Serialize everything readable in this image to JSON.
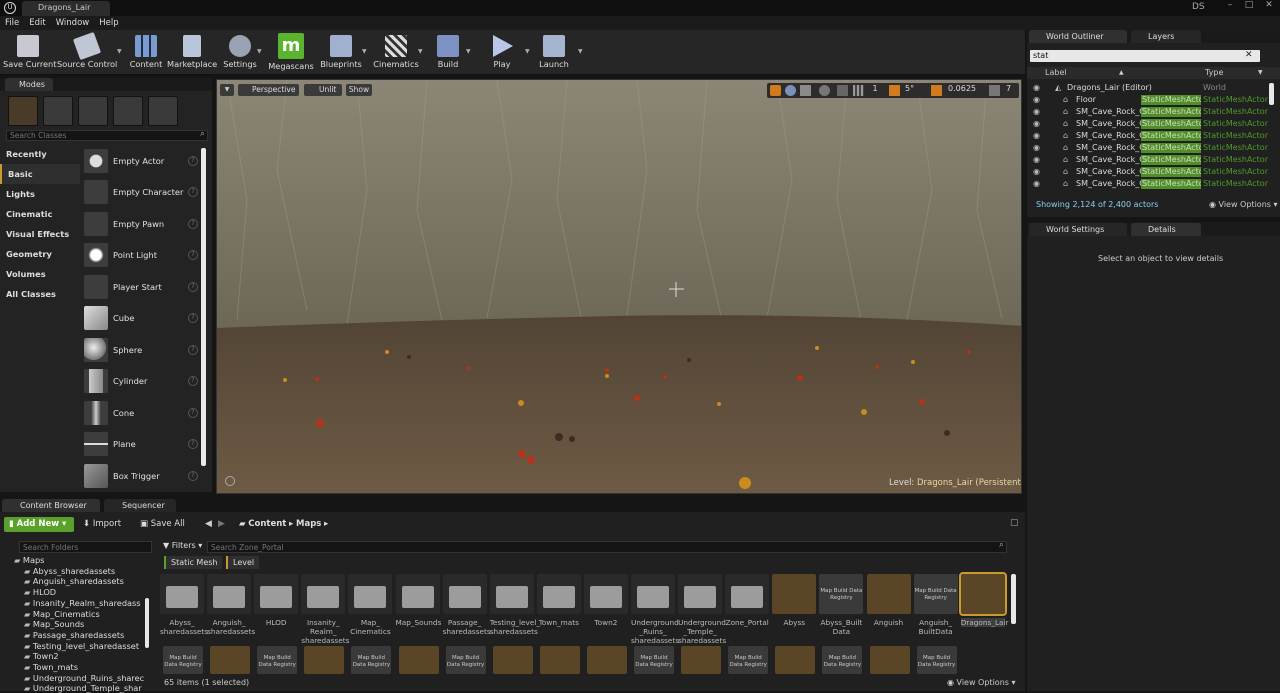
{
  "title_bar": {
    "tab": "Dragons_Lair",
    "user": "DS"
  },
  "menu": [
    "File",
    "Edit",
    "Window",
    "Help"
  ],
  "toolbar": [
    {
      "label": "Save Current",
      "icon": "save-icon"
    },
    {
      "label": "Source Control",
      "icon": "source-control-icon"
    },
    {
      "label": "Content",
      "icon": "content-icon"
    },
    {
      "label": "Marketplace",
      "icon": "marketplace-icon"
    },
    {
      "label": "Settings",
      "icon": "settings-icon"
    },
    {
      "label": "Megascans",
      "icon": "megascans-icon"
    },
    {
      "label": "Blueprints",
      "icon": "blueprints-icon"
    },
    {
      "label": "Cinematics",
      "icon": "cinematics-icon"
    },
    {
      "label": "Build",
      "icon": "build-icon"
    },
    {
      "label": "Play",
      "icon": "play-icon"
    },
    {
      "label": "Launch",
      "icon": "launch-icon"
    }
  ],
  "modes": {
    "tab": "Modes",
    "search_placeholder": "Search Classes",
    "categories": [
      "Recently Placed",
      "Basic",
      "Lights",
      "Cinematic",
      "Visual Effects",
      "Geometry",
      "Volumes",
      "All Classes"
    ],
    "selected_category": "Basic",
    "items": [
      "Empty Actor",
      "Empty Character",
      "Empty Pawn",
      "Point Light",
      "Player Start",
      "Cube",
      "Sphere",
      "Cylinder",
      "Cone",
      "Plane",
      "Box Trigger"
    ]
  },
  "viewport": {
    "perspective": "Perspective",
    "lit": "Unlit",
    "show": "Show",
    "grid": "1",
    "rotation": "5°",
    "scale": "0.0625",
    "camera_speed": "7",
    "level_label": "Level:",
    "level_name": "Dragons_Lair (Persistent)"
  },
  "outliner": {
    "tabs": [
      "World Outliner",
      "Layers"
    ],
    "search_value": "stat",
    "col_label": "Label",
    "col_type": "Type",
    "rows": [
      {
        "label": "Dragons_Lair (Editor)",
        "type": "World"
      },
      {
        "label": "Floor",
        "type": "StaticMeshActor"
      },
      {
        "label": "SM_Cave_Rock_Cl",
        "type": "StaticMeshActor"
      },
      {
        "label": "SM_Cave_Rock_Cl",
        "type": "StaticMeshActor"
      },
      {
        "label": "SM_Cave_Rock_Cl",
        "type": "StaticMeshActor"
      },
      {
        "label": "SM_Cave_Rock_Cl",
        "type": "StaticMeshActor"
      },
      {
        "label": "SM_Cave_Rock_Cl",
        "type": "StaticMeshActor"
      },
      {
        "label": "SM_Cave_Rock_Cl",
        "type": "StaticMeshActor"
      },
      {
        "label": "SM_Cave_Rock_Cl",
        "type": "StaticMeshActor"
      }
    ],
    "status": "Showing 2,124 of 2,400 actors",
    "view_options": "View Options"
  },
  "details": {
    "tabs": [
      "World Settings",
      "Details"
    ],
    "empty_message": "Select an object to view details"
  },
  "content_browser": {
    "tabs": [
      "Content Browser",
      "Sequencer"
    ],
    "add_new": "Add New",
    "import": "Import",
    "save_all": "Save All",
    "path": [
      "Content",
      "Maps"
    ],
    "folder_search_placeholder": "Search Folders",
    "folders": [
      "Maps",
      "Abyss_sharedassets",
      "Anguish_sharedassets",
      "HLOD",
      "Insanity_Realm_sharedass",
      "Map_Cinematics",
      "Map_Sounds",
      "Passage_sharedassets",
      "Testing_level_sharedasset",
      "Town2",
      "Town_mats",
      "Underground_Ruins_sharec",
      "Underground_Temple_shar"
    ],
    "filters": "Filters",
    "asset_search_placeholder": "Search Zone_Portal",
    "filter_chips": [
      "Static Mesh",
      "Level"
    ],
    "assets": [
      {
        "name": "Abyss_ sharedassets",
        "kind": "folder"
      },
      {
        "name": "Anguish_ sharedassets",
        "kind": "folder"
      },
      {
        "name": "HLOD",
        "kind": "folder"
      },
      {
        "name": "Insanity_ Realm_ sharedassets",
        "kind": "folder"
      },
      {
        "name": "Map_ Cinematics",
        "kind": "folder"
      },
      {
        "name": "Map_Sounds",
        "kind": "folder"
      },
      {
        "name": "Passage_ sharedassets",
        "kind": "folder"
      },
      {
        "name": "Testing_level_ sharedassets",
        "kind": "folder"
      },
      {
        "name": "Town_mats",
        "kind": "folder"
      },
      {
        "name": "Town2",
        "kind": "folder"
      },
      {
        "name": "Underground _Ruins_ sharedassets",
        "kind": "folder"
      },
      {
        "name": "Underground _Temple_ sharedassets",
        "kind": "folder"
      },
      {
        "name": "Zone_Portal",
        "kind": "folder"
      },
      {
        "name": "Abyss",
        "kind": "level"
      },
      {
        "name": "Abyss_Built Data",
        "kind": "mapbuild"
      },
      {
        "name": "Anguish",
        "kind": "level"
      },
      {
        "name": "Anguish_ BuiltData",
        "kind": "mapbuild"
      },
      {
        "name": "Dragons_Lair",
        "kind": "level"
      }
    ],
    "mapbuild_caption": "Map Build Data Registry",
    "status": "65 items (1 selected)",
    "view_options": "View Options"
  },
  "colors": {
    "accent_green": "#5aa12b",
    "highlight": "#7bd321",
    "selection": "#c99a2e"
  }
}
